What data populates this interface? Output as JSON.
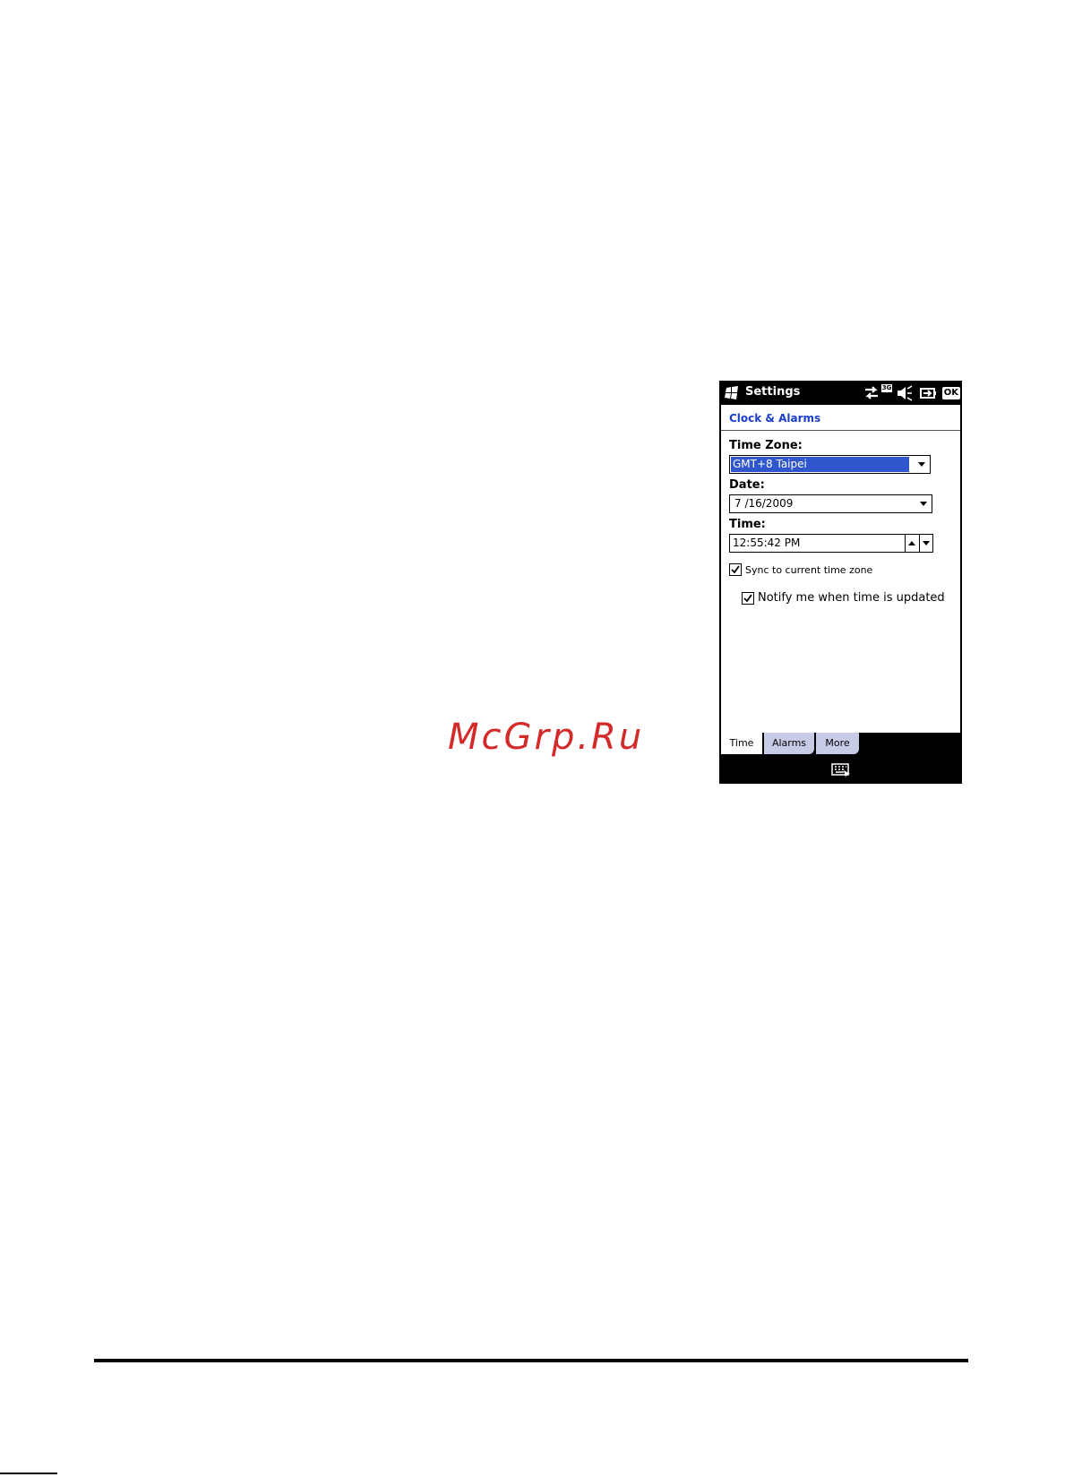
{
  "watermark": "McGrp.Ru",
  "device": {
    "app_title": "Settings",
    "status": {
      "network_icon": "data-arrows-icon",
      "network_label": "3G",
      "volume_icon": "speaker-mute-icon",
      "battery_icon": "battery-icon",
      "ok_label": "OK"
    },
    "section_title": "Clock & Alarms",
    "time_zone": {
      "label": "Time Zone:",
      "value": "GMT+8 Taipei"
    },
    "date": {
      "label": "Date:",
      "value": "7 /16/2009"
    },
    "time": {
      "label": "Time:",
      "value": "12:55:42 PM"
    },
    "sync_option": {
      "label": "Sync to current time zone",
      "checked": true
    },
    "notify_option": {
      "label": "Notify me when time is updated",
      "checked": true
    },
    "tabs": [
      {
        "label": "Time",
        "active": true
      },
      {
        "label": "Alarms",
        "active": false
      },
      {
        "label": "More",
        "active": false
      }
    ],
    "softbar_icon": "keyboard-icon"
  },
  "colors": {
    "accent_blue": "#1b3ec9",
    "selection_blue": "#2f56cc",
    "tab_inactive": "#c8cbe6",
    "watermark_red": "#d42a2a"
  }
}
